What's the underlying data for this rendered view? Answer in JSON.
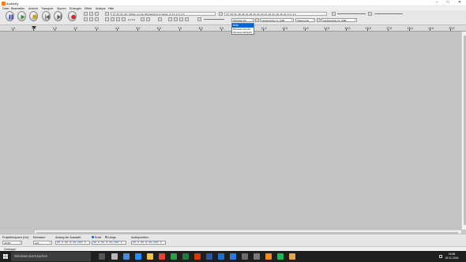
{
  "window": {
    "title": "Audacity",
    "minimize": "–",
    "maximize": "□",
    "close": "✕"
  },
  "menu": [
    "Datei",
    "Bearbeiten",
    "Ansicht",
    "Transport",
    "Spuren",
    "Erzeugen",
    "Effekt",
    "Analyse",
    "Hilfe"
  ],
  "meters": {
    "record_text": "-57 -54 -51 -48 - Klicken, um die Überwachung zu starten -9 -12 -9 -6 -3 0",
    "play_text": "-57 -54 -51 -48 -45 -42 -39 -36 -33 -30 -27 -24 -21 -18 -15 -12 -9 -6 -3 0"
  },
  "edit_tools": {
    "zoom_values": "0,1 0,1"
  },
  "device": {
    "host": "Windows Wi",
    "host_options": [
      "MME",
      "Windows DirectS",
      "Windows WASAPI"
    ],
    "host_selected": "MME",
    "mic_label": "Lautsprecher (2- USB",
    "channels": "(Stereo) Au",
    "playback": "Lautsprecher (2- USB"
  },
  "ruler": {
    "ticks": [
      "1,0",
      "0,0",
      "1,0",
      "2,0",
      "3,0",
      "4,0",
      "5,0",
      "6,0",
      "7,0",
      "8,0",
      "9,0",
      "10,0",
      "11,0",
      "12,0",
      "13,0",
      "14,0",
      "15,0",
      "16,0",
      "17,0",
      "18,0",
      "19,0",
      "20,0"
    ]
  },
  "selection_bar": {
    "rate_label": "Projektfrequenz (Hz):",
    "rate_value": "44100",
    "snap_label": "Einrasten:",
    "snap_value": "Aus",
    "start_label": "Anfang der Auswahl:",
    "start_value": "00 h 00 m 00,000 s",
    "end_radio": "Ende",
    "length_radio": "Länge",
    "end_value": "00 h 00 m 00,000 s",
    "audio_pos_label": "Audioposition:",
    "audio_pos_value": "00 h 00 m 00,000 s"
  },
  "status": {
    "text": "Gestoppt."
  },
  "taskbar": {
    "search_placeholder": "Windows durchsuchen",
    "time": "16:58",
    "date": "25.11.2016"
  },
  "colors": {
    "track_bg": "#c3c3c3",
    "highlight": "#0a64d6",
    "record_red": "#d9262a",
    "play_green": "#2a9b2a"
  }
}
